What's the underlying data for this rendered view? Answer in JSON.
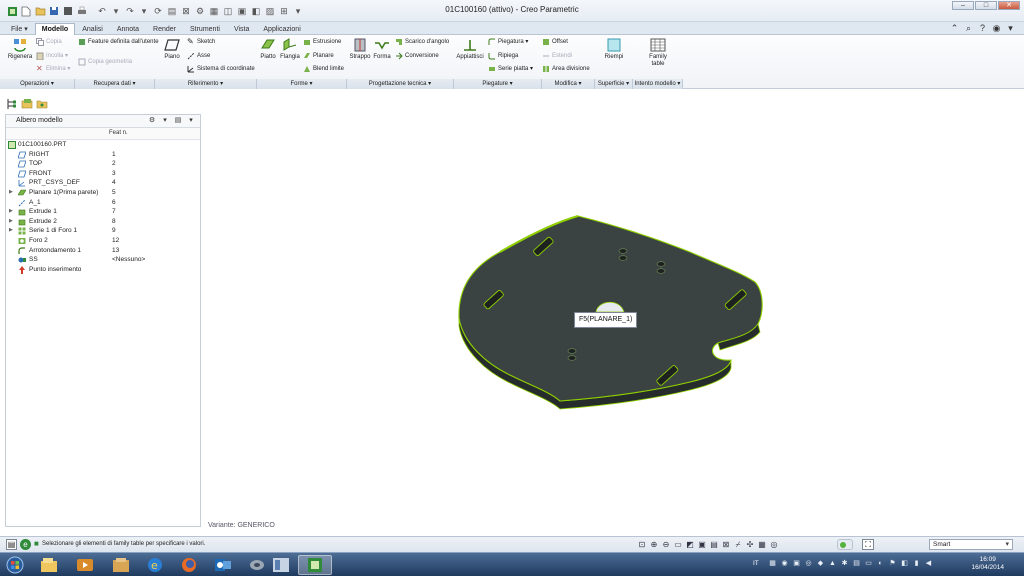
{
  "app": {
    "title": "01C100160 (attivo) - Creo Parametric"
  },
  "window_controls": {
    "minimize": "–",
    "maximize": "□",
    "close": "✕"
  },
  "ribbon_tabs": [
    {
      "label": "File",
      "dropdown": "▾"
    },
    {
      "label": "Modello",
      "active": true
    },
    {
      "label": "Analisi"
    },
    {
      "label": "Annota"
    },
    {
      "label": "Render"
    },
    {
      "label": "Strumenti"
    },
    {
      "label": "Vista"
    },
    {
      "label": "Applicazioni"
    }
  ],
  "ribbon": {
    "operazioni": {
      "label": "Operazioni ▾",
      "rigenera": "Rigenera",
      "copia": "Copia",
      "incolla": "Incolla ▾",
      "elimina": "Elimina ▾"
    },
    "recupera": {
      "label": "Recupera dati ▾",
      "feature_utente": "Feature definita dall'utente",
      "copia_geometria": "Copia geometria"
    },
    "riferimento": {
      "label": "Riferimento ▾",
      "piano": "Piano",
      "sketch": "Sketch",
      "asse": "Asse",
      "sistema": "Sistema di coordinate"
    },
    "forme": {
      "label": "Forme ▾",
      "piatto": "Piatto",
      "flangia": "Flangia",
      "estrusione": "Estrusione",
      "planare": "Planare",
      "blend": "Blend limite"
    },
    "progettazione": {
      "label": "Progettazione tecnica ▾",
      "strappo": "Strappo",
      "forma": "Forma",
      "scarico": "Scarico d'angolo",
      "conversione": "Conversione"
    },
    "piegature": {
      "label": "Piegature ▾",
      "appiattisci": "Appiattisci",
      "piegatura": "Piegatura ▾",
      "ripiega": "Ripiega",
      "serie": "Serie piatta ▾"
    },
    "modifica": {
      "label": "Modifica ▾",
      "offset": "Offset",
      "estendi": "Estendi",
      "area": "Area divisione"
    },
    "superficie": {
      "label": "Superficie ▾",
      "riempi": "Riempi"
    },
    "intento": {
      "label": "Intento modello ▾",
      "family1": "Family",
      "family2": "table"
    }
  },
  "tree": {
    "title": "Albero modello",
    "col_feat": "Feat n.",
    "root": "01C100160.PRT",
    "items": [
      {
        "label": "RIGHT",
        "num": "1",
        "icon": "datum-plane-icon"
      },
      {
        "label": "TOP",
        "num": "2",
        "icon": "datum-plane-icon"
      },
      {
        "label": "FRONT",
        "num": "3",
        "icon": "datum-plane-icon"
      },
      {
        "label": "PRT_CSYS_DEF",
        "num": "4",
        "icon": "csys-icon"
      },
      {
        "label": "Planare 1(Prima parete)",
        "num": "5",
        "icon": "sheetmetal-wall-icon",
        "expand": "▶"
      },
      {
        "label": "A_1",
        "num": "6",
        "icon": "axis-icon"
      },
      {
        "label": "Extrude 1",
        "num": "7",
        "icon": "extrude-icon",
        "expand": "▶"
      },
      {
        "label": "Extrude 2",
        "num": "8",
        "icon": "extrude-icon",
        "expand": "▶"
      },
      {
        "label": "Serie 1 di Foro 1",
        "num": "9",
        "icon": "pattern-icon",
        "expand": "▶"
      },
      {
        "label": "Foro 2",
        "num": "12",
        "icon": "hole-icon"
      },
      {
        "label": "Arrotondamento 1",
        "num": "13",
        "icon": "round-icon"
      },
      {
        "label": "SS",
        "num": "<Nessuno>",
        "icon": "view-state-icon"
      },
      {
        "label": "Punto inserimento",
        "num": "",
        "icon": "insert-arrow-icon"
      }
    ]
  },
  "viewport": {
    "tooltip": "F5(PLANARE_1)",
    "variant": "Variante: GENERICO"
  },
  "status": {
    "message": "Selezionare gli elementi di family table per specificare i valori.",
    "filter": "Smart"
  },
  "taskbar": {
    "lang": "IT",
    "time": "16:09",
    "date": "16/04/2014"
  },
  "colors": {
    "part_fill": "#3b4342",
    "part_edge": "#8fd000",
    "accent": "#2a6db5"
  }
}
